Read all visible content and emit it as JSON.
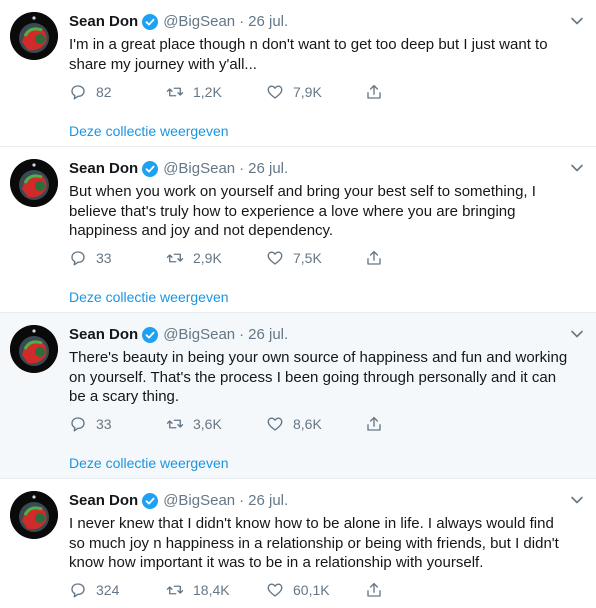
{
  "colors": {
    "link": "#1b95e0",
    "secondary_text": "#657786",
    "primary_text": "#14171a",
    "verified_badge": "#1da1f2",
    "alt_row_background": "#f5f8fa"
  },
  "icons": {
    "reply": "reply-icon",
    "retweet": "retweet-icon",
    "like": "like-icon",
    "share": "share-icon",
    "caret": "chevron-down-icon",
    "verified": "verified-badge-icon"
  },
  "tweets": [
    {
      "name": "Sean Don",
      "handle": "@BigSean",
      "separator": "·",
      "time": "26 jul.",
      "text": "I'm in a great place though n don't want to get too deep but I just want to share my journey with y'all...",
      "replies": "82",
      "retweets": "1,2K",
      "likes": "7,9K",
      "collection_link": "Deze collectie weergeven"
    },
    {
      "name": "Sean Don",
      "handle": "@BigSean",
      "separator": "·",
      "time": "26 jul.",
      "text": "But when you work on yourself and bring your best self to something, I believe that's truly how to experience a love where you are bringing happiness and joy and not dependency.",
      "replies": "33",
      "retweets": "2,9K",
      "likes": "7,5K",
      "collection_link": "Deze collectie weergeven"
    },
    {
      "name": "Sean Don",
      "handle": "@BigSean",
      "separator": "·",
      "time": "26 jul.",
      "text": "There's beauty in being your own source of happiness and fun and working on yourself. That's the process I been going through personally and it can be a scary thing.",
      "replies": "33",
      "retweets": "3,6K",
      "likes": "8,6K",
      "collection_link": "Deze collectie weergeven"
    },
    {
      "name": "Sean Don",
      "handle": "@BigSean",
      "separator": "·",
      "time": "26 jul.",
      "text": "I never knew that I didn't know how to be alone in life. I always would find so much joy n happiness in a relationship or being with friends, but I didn't know how important it was to be in a relationship with yourself.",
      "replies": "324",
      "retweets": "18,4K",
      "likes": "60,1K"
    }
  ]
}
